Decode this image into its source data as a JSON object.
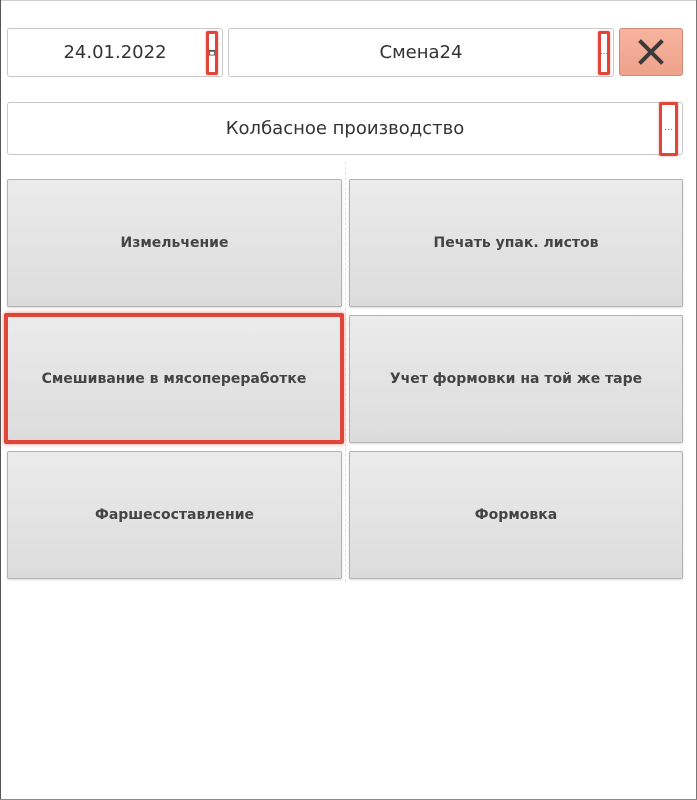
{
  "header": {
    "date": {
      "value": "24.01.2022",
      "button_icon": "calendar-icon"
    },
    "shift": {
      "value": "Смена24",
      "button_label": "..."
    },
    "close_icon": "close-x-icon",
    "close_color": "#f2a78f"
  },
  "department": {
    "value": "Колбасное производство",
    "button_label": "..."
  },
  "tiles": [
    {
      "label": "Измельчение"
    },
    {
      "label": "Печать упак. листов"
    },
    {
      "label": "Смешивание в мясопереработке"
    },
    {
      "label": "Учет формовки на той же таре"
    },
    {
      "label": "Фаршесоставление"
    },
    {
      "label": "Формовка"
    }
  ],
  "accent": "#e0453a"
}
